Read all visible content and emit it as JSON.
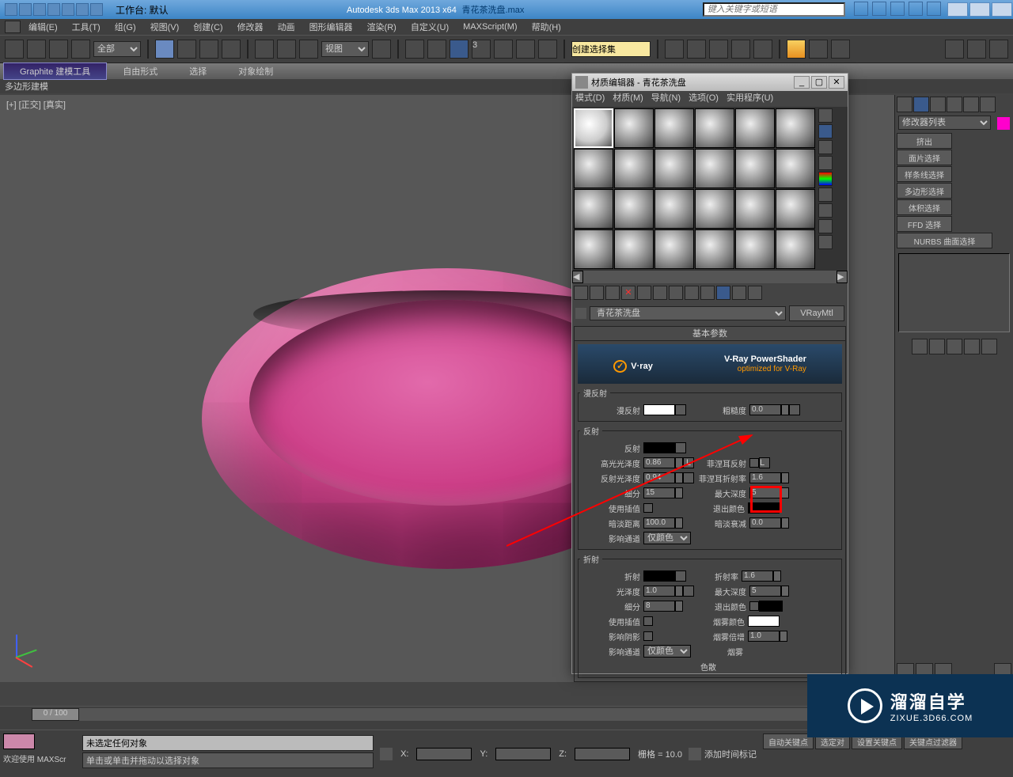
{
  "titlebar": {
    "workspace_label": "工作台: 默认",
    "app": "Autodesk 3ds Max  2013 x64",
    "file": "青花茶洗盘.max",
    "search_placeholder": "键入关键字或短语"
  },
  "menus": [
    "编辑(E)",
    "工具(T)",
    "组(G)",
    "视图(V)",
    "创建(C)",
    "修改器",
    "动画",
    "图形编辑器",
    "渲染(R)",
    "自定义(U)",
    "MAXScript(M)",
    "帮助(H)"
  ],
  "toolbar": {
    "filter": "全部",
    "view": "视图",
    "create_select_set": "创建选择集"
  },
  "ribbon": {
    "tabs": [
      "Graphite 建模工具",
      "自由形式",
      "选择",
      "对象绘制"
    ],
    "sub": "多边形建模"
  },
  "viewport": {
    "label": "[+] [正交] [真实]"
  },
  "modpanel": {
    "list": "修改器列表",
    "buttons": [
      "挤出",
      "面片选择",
      "样条线选择",
      "多边形选择",
      "体积选择",
      "FFD 选择",
      "NURBS 曲面选择"
    ]
  },
  "medit": {
    "title": "材质编辑器 - 青花茶洗盘",
    "menus": [
      "模式(D)",
      "材质(M)",
      "导航(N)",
      "选项(O)",
      "实用程序(U)"
    ],
    "matname": "青花茶洗盘",
    "mattype": "VRayMtl",
    "rollout_basic": "基本参数",
    "vray_title": "V-Ray PowerShader",
    "vray_sub": "optimized for V-Ray",
    "diffuse_group": "漫反射",
    "diffuse_label": "漫反射",
    "roughness_label": "粗糙度",
    "roughness_val": "0.0",
    "reflect_group": "反射",
    "reflect_label": "反射",
    "hilight_label": "高光光泽度",
    "hilight_val": "0.86",
    "refl_gloss_label": "反射光泽度",
    "refl_gloss_val": "0.94",
    "fresnel_label": "菲涅耳反射",
    "fresnel_ior_label": "菲涅耳折射率",
    "fresnel_ior_val": "1.6",
    "subdiv_label": "细分",
    "subdiv_val": "15",
    "max_depth_label": "最大深度",
    "max_depth_val": "5",
    "use_interp_label": "使用插值",
    "exit_color_label": "退出颜色",
    "dim_dist_label": "暗淡距离",
    "dim_dist_val": "100.0",
    "dim_falloff_label": "暗淡衰减",
    "dim_falloff_val": "0.0",
    "affect_label": "影响通道",
    "affect_val": "仅颜色",
    "refract_group": "折射",
    "refract_label": "折射",
    "ior_label": "折射率",
    "ior_val": "1.6",
    "gloss_label": "光泽度",
    "gloss_val": "1.0",
    "refract_maxdepth_val": "5",
    "refract_subdiv_val": "8",
    "affect_shadow_label": "影响阴影",
    "fog_color_label": "烟雾颜色",
    "fog_mult_label": "烟雾倍增",
    "fog_mult_val": "1.0",
    "fog_label": "烟雾",
    "dispersion_label": "色散"
  },
  "timeline": {
    "frame": "0 / 100"
  },
  "status": {
    "welcome": "欢迎使用  MAXScr",
    "line1": "未选定任何对象",
    "line2": "单击或单击并拖动以选择对象",
    "grid": "栅格 = 10.0",
    "add_time_tag": "添加时间标记",
    "autokey": "自动关键点",
    "setkey": "设置关键点",
    "sel_lock": "选定对",
    "keyfilter": "关键点过滤器"
  },
  "watermark": {
    "big": "溜溜自学",
    "small": "ZIXUE.3D66.COM"
  },
  "vray_logo": "V·ray"
}
